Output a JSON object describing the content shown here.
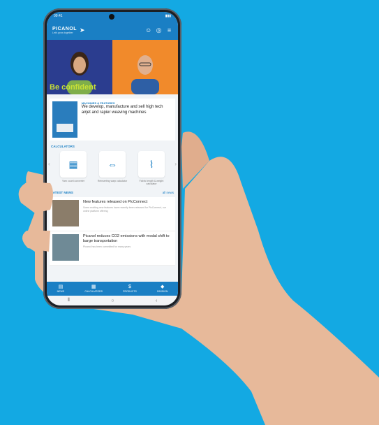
{
  "app": {
    "brand": "PICANOL",
    "tagline": "Let's grow together"
  },
  "status_bar": {
    "time": "09:41"
  },
  "hero": {
    "caption": "Be confident"
  },
  "feature_card": {
    "category": "MACHINES & FEATURES",
    "description": "We develop, manufacture and sell high tech airjet and rapier weaving machines"
  },
  "calculators": {
    "title": "CALCULATORS",
    "items": [
      {
        "label": "Yarn count converter",
        "icon": "yarn-icon"
      },
      {
        "label": "Reinserting warp calculator",
        "icon": "warp-icon"
      },
      {
        "label": "Fabric length & weight calculator",
        "icon": "fabric-icon"
      }
    ]
  },
  "news": {
    "title": "LATEST NEWS",
    "all_link": "all news",
    "items": [
      {
        "title": "New features released on PicConnect",
        "snippet": "Some exciting new features have recently been released for PicConnect, our online platform offering"
      },
      {
        "title": "Picanol reduces CO2 emissions with modal shift to barge transportation",
        "snippet": "Picanol has been committed for many years"
      }
    ]
  },
  "bottom_nav": [
    {
      "label": "NEWS",
      "icon": "news-icon"
    },
    {
      "label": "CALCULATORS",
      "icon": "calculator-icon"
    },
    {
      "label": "PRODUCTS",
      "icon": "products-icon"
    },
    {
      "label": "PASSION",
      "icon": "passion-icon"
    }
  ],
  "colors": {
    "background": "#13a9e3",
    "brand_blue": "#1a7fc4",
    "hero_accent": "#c8e036"
  }
}
